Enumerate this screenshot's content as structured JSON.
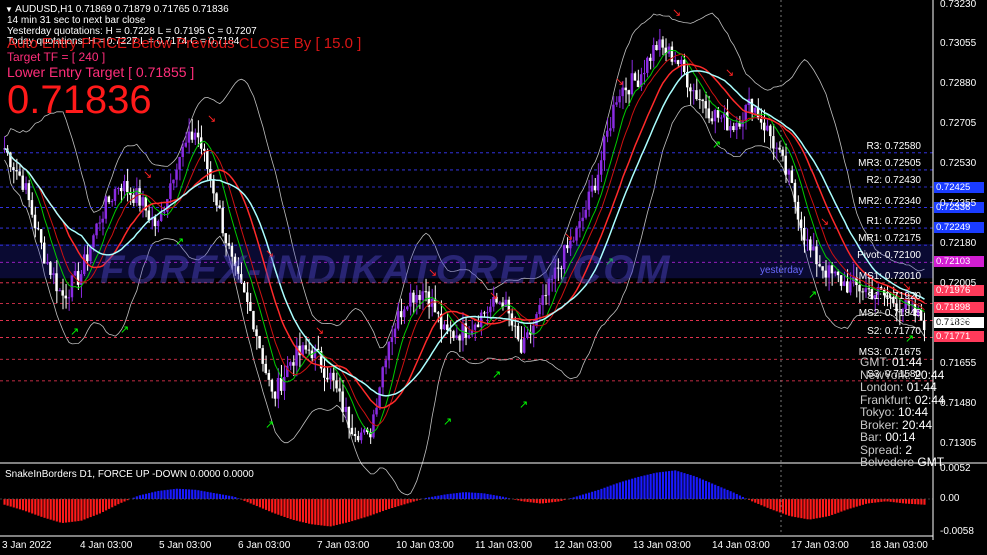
{
  "symbol_header": "AUDUSD,H1  0.71869 0.71879 0.71765 0.71836",
  "timer_text": "14 min 31 sec to next bar close",
  "yesterday_quote": "Yesterday quotations: H = 0.7228  L = 0.7195  C = 0.7207",
  "today_quote": "Today quotations: H = 0.7227  L = 0.7174  C = 0.7184",
  "overlay_warning": "Auto Entry PRICE Below Previous CLOSE By [ 15.0 ]",
  "target_tf": "Target  TF = [ 240 ]",
  "lower_entry": "Lower Entry Target [ 0.71855 ]",
  "big_price": "0.71836",
  "watermark": "FOREX-INDIKATOREN.COM",
  "pivot_levels": [
    {
      "label": "R3: 0.72580",
      "value": 0.7258
    },
    {
      "label": "MR3: 0.72505",
      "value": 0.72505
    },
    {
      "label": "R2: 0.72430",
      "value": 0.7243
    },
    {
      "label": "MR2: 0.72340",
      "value": 0.7234
    },
    {
      "label": "R1: 0.72250",
      "value": 0.7225
    },
    {
      "label": "MR1: 0.72175",
      "value": 0.72175
    },
    {
      "label": "Pivot: 0.72100",
      "value": 0.721
    },
    {
      "label": "MS1: 0.72010",
      "value": 0.7201
    },
    {
      "label": "S1: 0.71920",
      "value": 0.7192
    },
    {
      "label": "MS2: 0.71845",
      "value": 0.71845
    },
    {
      "label": "S2: 0.71770",
      "value": 0.7177
    },
    {
      "label": "MS3: 0.71675",
      "value": 0.71675
    },
    {
      "label": "S3: 0.71580",
      "value": 0.7158
    }
  ],
  "price_tags": [
    {
      "text": "0.72425",
      "value": 0.72425,
      "bg": "#1a3cff"
    },
    {
      "text": "0.72336",
      "value": 0.72336,
      "bg": "#1a3cff"
    },
    {
      "text": "0.72249",
      "value": 0.72249,
      "bg": "#1a3cff"
    },
    {
      "text": "0.72103",
      "value": 0.72103,
      "bg": "#d21ed2"
    },
    {
      "text": "0.71976",
      "value": 0.71976,
      "bg": "#ff3a5a"
    },
    {
      "text": "0.71898",
      "value": 0.71898,
      "bg": "#ff3a5a"
    },
    {
      "text": "0.71836",
      "value": 0.71836,
      "bg": "#ffffff"
    },
    {
      "text": "0.71771",
      "value": 0.71771,
      "bg": "#ff3a5a"
    }
  ],
  "yesterday_level_label": "yesterday",
  "sessions": [
    {
      "name": "GMT:",
      "time": "01:44"
    },
    {
      "name": "NewYork:",
      "time": "20:44"
    },
    {
      "name": "London:",
      "time": "01:44"
    },
    {
      "name": "Frankfurt:",
      "time": "02:44"
    },
    {
      "name": "Tokyo:",
      "time": "10:44"
    },
    {
      "name": "Broker:",
      "time": "20:44"
    },
    {
      "name": "Bar:",
      "time": "00:14"
    },
    {
      "name": "Spread:",
      "time": "2"
    },
    {
      "name": "Belvedere",
      "time": "GMT"
    }
  ],
  "sub_title": "SnakeInBorders D1, FORCE UP -DOWN  0.0000 0.0000",
  "chart_data": {
    "type": "candlestick",
    "symbol": "AUDUSD",
    "timeframe": "H1",
    "ylim": [
      0.7122,
      0.7325
    ],
    "y_ticks": [
      "0.73230",
      "0.73055",
      "0.72880",
      "0.72705",
      "0.72530",
      "0.72355",
      "0.72180",
      "0.72005",
      "0.71830",
      "0.71655",
      "0.71480",
      "0.71305"
    ],
    "y_tick_values": [
      0.7323,
      0.73055,
      0.7288,
      0.72705,
      0.7253,
      0.72355,
      0.7218,
      0.72005,
      0.7183,
      0.71655,
      0.7148,
      0.71305
    ],
    "x_labels": [
      "3 Jan 2022",
      "4 Jan 03:00",
      "5 Jan 03:00",
      "6 Jan 03:00",
      "7 Jan 03:00",
      "10 Jan 03:00",
      "11 Jan 03:00",
      "12 Jan 03:00",
      "13 Jan 03:00",
      "14 Jan 03:00",
      "17 Jan 03:00",
      "18 Jan 03:00"
    ],
    "close_path": [
      0.726,
      0.7245,
      0.7215,
      0.7195,
      0.7205,
      0.723,
      0.7245,
      0.7238,
      0.7225,
      0.7255,
      0.7268,
      0.724,
      0.7205,
      0.7185,
      0.715,
      0.7168,
      0.7172,
      0.716,
      0.714,
      0.7132,
      0.7175,
      0.7195,
      0.7198,
      0.7178,
      0.718,
      0.7188,
      0.7194,
      0.717,
      0.719,
      0.721,
      0.7225,
      0.725,
      0.7285,
      0.729,
      0.7305,
      0.73,
      0.7285,
      0.7275,
      0.727,
      0.728,
      0.7265,
      0.7245,
      0.7215,
      0.7205,
      0.72,
      0.7198,
      0.7195,
      0.719,
      0.7184
    ],
    "sub_axis": {
      "labels": [
        "0.0052",
        "0.00",
        "-0.0058"
      ],
      "values": [
        0.0052,
        0.0,
        -0.0058
      ]
    },
    "sub_hist": [
      -0.001,
      -0.002,
      -0.0032,
      -0.0042,
      -0.0038,
      -0.0025,
      -0.0008,
      0.0006,
      0.0014,
      0.0018,
      0.0016,
      0.001,
      0.0004,
      -0.001,
      -0.0024,
      -0.0036,
      -0.0044,
      -0.0048,
      -0.004,
      -0.003,
      -0.0018,
      -0.0008,
      0.0002,
      0.0008,
      0.0012,
      0.001,
      0.0004,
      -0.0004,
      -0.0008,
      -0.0004,
      0.0006,
      0.0016,
      0.0028,
      0.0038,
      0.0046,
      0.005,
      0.004,
      0.0026,
      0.0012,
      -0.0004,
      -0.0018,
      -0.003,
      -0.0036,
      -0.003,
      -0.0018,
      -0.0008,
      -0.0004,
      -0.0008,
      -0.001
    ]
  },
  "colors": {
    "up": "#8a2be2",
    "down": "#ffffff",
    "red_line": "#ff2a2a",
    "green_line": "#00ff00",
    "cyan_line": "#aaffff",
    "band": "#bfbfbf",
    "sub_up": "#1a1aff",
    "sub_down": "#ff1a1a"
  }
}
